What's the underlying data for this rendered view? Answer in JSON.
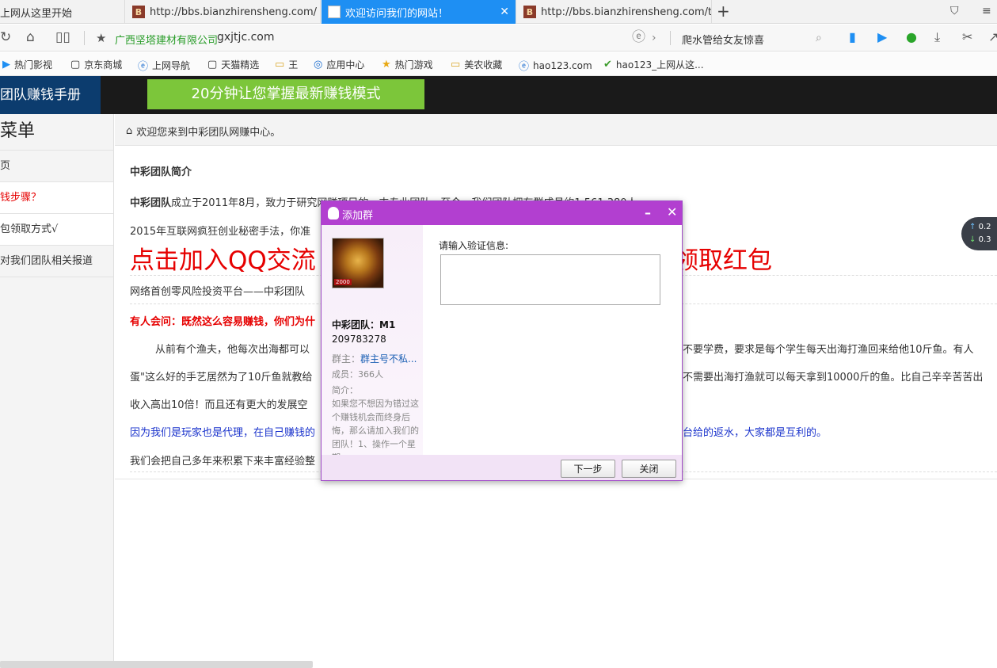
{
  "browser": {
    "tabs": [
      {
        "label": "上网从这里开始",
        "favicon": "none",
        "active": false
      },
      {
        "label": "http://bbs.bianzhirensheng.com/",
        "favicon": "bz-favicon-icon",
        "active": false
      },
      {
        "label": "欢迎访问我们的网站！",
        "favicon": "document-icon",
        "active": true
      },
      {
        "label": "http://bbs.bianzhirensheng.com/th",
        "favicon": "bz-favicon-icon",
        "active": false
      }
    ],
    "address": {
      "site_name": "广西坚塔建材有限公司",
      "url": "gxjtjc.com",
      "search_text": "爬水管给女友惊喜"
    },
    "bookmarks": [
      {
        "label": "热门影视",
        "icon": "play-icon"
      },
      {
        "label": "京东商城",
        "icon": "document-icon"
      },
      {
        "label": "上网导航",
        "icon": "ie-icon"
      },
      {
        "label": "天猫精选",
        "icon": "document-icon"
      },
      {
        "label": "王",
        "icon": "folder-icon"
      },
      {
        "label": "应用中心",
        "icon": "apps-icon"
      },
      {
        "label": "热门游戏",
        "icon": "star-icon"
      },
      {
        "label": "美农收藏",
        "icon": "folder-icon"
      },
      {
        "label": "hao123.com",
        "icon": "ie-icon"
      },
      {
        "label": "hao123_上网从这...",
        "icon": "hao-icon"
      }
    ]
  },
  "site": {
    "logo": "团队赚钱手册",
    "banner": "20分钟让您掌握最新赚钱模式",
    "accent": "#7cc63a",
    "brand": "#0c3c6e"
  },
  "sidebar": {
    "title": "菜单",
    "items": [
      {
        "label": "页"
      },
      {
        "label": "钱步骤？"
      },
      {
        "label": "包领取方式√"
      },
      {
        "label": "对我们团队相关报道"
      }
    ]
  },
  "main": {
    "breadcrumb": "欢迎您来到中彩团队网赚中心。",
    "heading": "中彩团队简介",
    "para1_bold": "中彩团队",
    "para1": "成立于2011年8月，致力于研究网赚项目的一支专业团队，至今，我们团队拥有群成员约1,561,380人",
    "para2": "2015年互联网疯狂创业秘密手法，你准",
    "big_left": "点击加入QQ交流",
    "big_right": "领取红包",
    "para3": "网络首创零风险投资平台——中彩团队",
    "question": "有人会问：既然这么容易赚钱，你们为什",
    "story1": "从前有个渔夫，他每次出海都可以",
    "story1_right": "，不要学费，要求是每个学生每天出海打渔回来给他10斤鱼。有人",
    "story2": "蛋\"这么好的手艺居然为了10斤鱼就教给",
    "story2_right": "，不需要出海打渔就可以每天拿到10000斤的鱼。比自己辛辛苦苦出",
    "story3": "收入高出10倍！而且还有更大的发展空",
    "blue_left": "因为我们是玩家也是代理，在自己赚钱的",
    "blue_right": "平台给的返水，大家都是互利的。",
    "last": "我们会把自己多年来积累下来丰富经验整"
  },
  "speed_widget": {
    "up": "0.2",
    "down": "0.3"
  },
  "dialog": {
    "title": "添加群",
    "group_name": "中彩团队：M1",
    "group_id": "209783278",
    "owner_label": "群主：",
    "owner": "群主号不私...",
    "members": "成员：366人",
    "intro_label": "简介：",
    "intro": "如果您不想因为错过这个赚钱机会而终身后悔，那么请加入我们的团队！1、操作一个星期",
    "avatar_badge": "2000",
    "verify_label": "请输入验证信息:",
    "verify_value": "",
    "next_button": "下一步",
    "close_button": "关闭",
    "header_color": "#b23fd0"
  }
}
